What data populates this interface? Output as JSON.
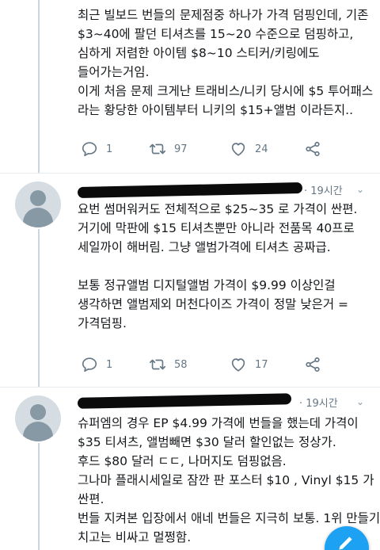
{
  "tweet1": {
    "lines": [
      "최근 빌보드 번들의 문제점중 하나가 가격 덤핑인데, 기존",
      "$3~40에 팔던 티셔츠를 15~20 수준으로 덤핑하고,",
      "심하게 저렴한 아이템 $8~10 스티커/키링에도",
      "들어가는거임.",
      "이게 처음 문제 크게난 트래비스/니키 당시에 $5 투어패스",
      "라는 황당한 아이템부터 니키의 $15+앨범 이라든지.."
    ],
    "reply_count": "1",
    "retweet_count": "97",
    "like_count": "24"
  },
  "tweet2": {
    "time": "· 19시간",
    "lines": [
      "요번 썸머워커도 전체적으로 $25~35 로 가격이 싼편.",
      "거기에 막판에 $15 티셔츠뿐만 아니라 전품목 40프로",
      "세일까이 해버림. 그냥 앨범가격에 티셔츠 공짜급."
    ],
    "lines2": [
      "보통 정규앨범 디지털앨범 가격이 $9.99 이상인걸",
      "생각하면 앨범제외 머천다이즈 가격이 정말 낮은거 =",
      "가격덤핑."
    ],
    "reply_count": "1",
    "retweet_count": "58",
    "like_count": "17"
  },
  "tweet3": {
    "time": "· 19시간",
    "lines": [
      "슈퍼엠의 경우 EP $4.99 가격에 번들을 했는데 가격이",
      "$35 티셔츠, 앨범빼면 $30 달러 할인없는 정상가.",
      "후드 $80 달러 ㄷㄷ, 나머지도 덤핑없음.",
      "그나마 플래시세일로 잠깐 판 포스터 $10 , Vinyl $15 가",
      "싼편.",
      "번들 지켜본 입장에서 애네 번들은 지극히 보통. 1위 만들기",
      "치고는 비싸고 멀쩡함."
    ]
  },
  "colors": {
    "accent": "#1da1f2",
    "icon_gray": "#657786",
    "thread_line": "#ccd6dd"
  },
  "icons": [
    "reply-icon",
    "retweet-icon",
    "like-icon",
    "share-icon",
    "chevron-down-icon",
    "compose-icon"
  ]
}
